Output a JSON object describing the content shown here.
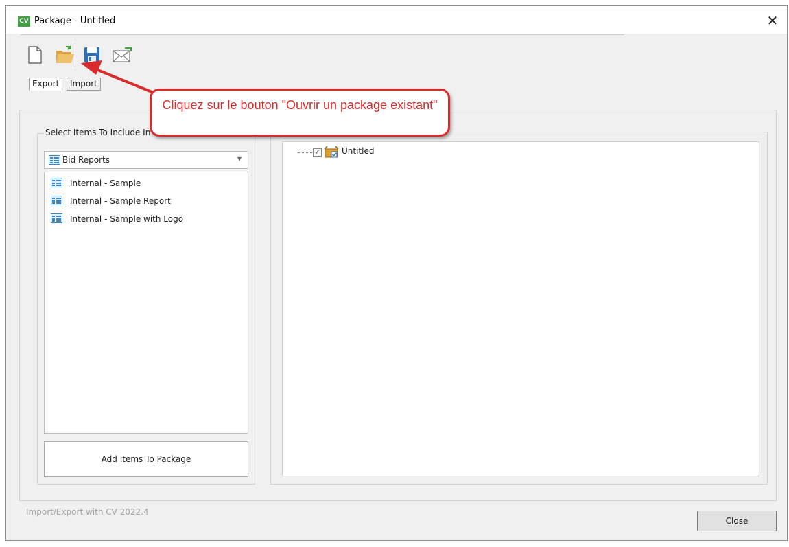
{
  "window": {
    "logo": "CV",
    "title": "Package - Untitled",
    "close_glyph": "✕"
  },
  "toolbar": {
    "buttons": [
      {
        "name": "new-package",
        "icon": "new-document-icon"
      },
      {
        "name": "open-package",
        "icon": "open-folder-icon"
      },
      {
        "name": "save-package",
        "icon": "floppy-disk-icon"
      },
      {
        "name": "email-package",
        "icon": "envelope-icon"
      }
    ]
  },
  "tabs": [
    {
      "label": "Export",
      "active": true
    },
    {
      "label": "Import",
      "active": false
    }
  ],
  "left_panel": {
    "group_label": "Select Items To Include In",
    "combo_value": "Bid Reports",
    "items": [
      {
        "label": "Internal - Sample"
      },
      {
        "label": "Internal - Sample Report"
      },
      {
        "label": "Internal - Sample with Logo"
      }
    ],
    "add_button": "Add Items To Package"
  },
  "right_panel": {
    "tree_root": "Untitled",
    "checked": true
  },
  "footer": {
    "version_text": "Import/Export with CV 2022.4",
    "close_button": "Close"
  },
  "annotation": {
    "callout_text": "Cliquez sur le bouton \"Ouvrir un package existant\"",
    "color": "#d92b2b"
  },
  "colors": {
    "window_bg": "#f0f0f0",
    "logo_green": "#43a047",
    "folder_gold": "#e9b24c",
    "save_blue": "#2a6fb8"
  }
}
